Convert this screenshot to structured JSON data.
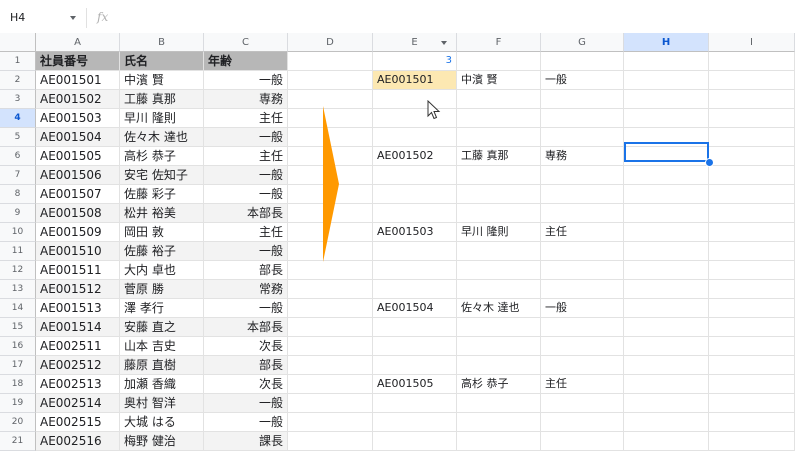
{
  "name_box": "H4",
  "formula_bar": {
    "fx_label": "fx",
    "value": ""
  },
  "columns": [
    {
      "key": "A",
      "label": "A"
    },
    {
      "key": "B",
      "label": "B"
    },
    {
      "key": "C",
      "label": "C"
    },
    {
      "key": "D",
      "label": "D"
    },
    {
      "key": "E",
      "label": "E",
      "has_filter": true
    },
    {
      "key": "F",
      "label": "F"
    },
    {
      "key": "G",
      "label": "G"
    },
    {
      "key": "H",
      "label": "H",
      "selected": true
    },
    {
      "key": "I",
      "label": "I"
    }
  ],
  "rows": [
    "1",
    "2",
    "3",
    "4",
    "5",
    "6",
    "7",
    "8",
    "9",
    "10",
    "11",
    "12",
    "13",
    "14",
    "15",
    "16",
    "17",
    "18",
    "19",
    "20",
    "21"
  ],
  "selected_row": "4",
  "table": {
    "headers": [
      "社員番号",
      "氏名",
      "年齢"
    ],
    "records": [
      [
        "AE001501",
        "中濱 賢",
        "一般"
      ],
      [
        "AE001502",
        "工藤 真那",
        "専務"
      ],
      [
        "AE001503",
        "早川 隆則",
        "主任"
      ],
      [
        "AE001504",
        "佐々木 達也",
        "一般"
      ],
      [
        "AE001505",
        "高杉 恭子",
        "主任"
      ],
      [
        "AE001506",
        "安宅 佐知子",
        "一般"
      ],
      [
        "AE001507",
        "佐藤 彩子",
        "一般"
      ],
      [
        "AE001508",
        "松井 裕美",
        "本部長"
      ],
      [
        "AE001509",
        "岡田 敦",
        "主任"
      ],
      [
        "AE001510",
        "佐藤 裕子",
        "一般"
      ],
      [
        "AE001511",
        "大内 卓也",
        "部長"
      ],
      [
        "AE001512",
        "菅原 勝",
        "常務"
      ],
      [
        "AE001513",
        "澤 孝行",
        "一般"
      ],
      [
        "AE001514",
        "安藤 直之",
        "本部長"
      ],
      [
        "AE002511",
        "山本 吉史",
        "次長"
      ],
      [
        "AE002512",
        "藤原 直樹",
        "部長"
      ],
      [
        "AE002513",
        "加瀬 香織",
        "次長"
      ],
      [
        "AE002514",
        "奥村 智洋",
        "一般"
      ],
      [
        "AE002515",
        "大城 はる",
        "一般"
      ],
      [
        "AE002516",
        "梅野 健治",
        "課長"
      ]
    ]
  },
  "output": {
    "step_value": "3",
    "blocks": [
      {
        "row": "2",
        "id": "AE001501",
        "name": "中濱 賢",
        "title": "一般"
      },
      {
        "row": "6",
        "id": "AE001502",
        "name": "工藤 真那",
        "title": "専務"
      },
      {
        "row": "10",
        "id": "AE001503",
        "name": "早川 隆則",
        "title": "主任"
      },
      {
        "row": "14",
        "id": "AE001504",
        "name": "佐々木 達也",
        "title": "一般"
      },
      {
        "row": "18",
        "id": "AE001505",
        "name": "高杉 恭子",
        "title": "主任"
      }
    ]
  },
  "colors": {
    "accent": "#1a73e8",
    "header_fill": "#b7b7b7",
    "band_fill": "#f3f3f3",
    "highlight_fill": "#fce8b2",
    "arrow": "#ff9900"
  }
}
